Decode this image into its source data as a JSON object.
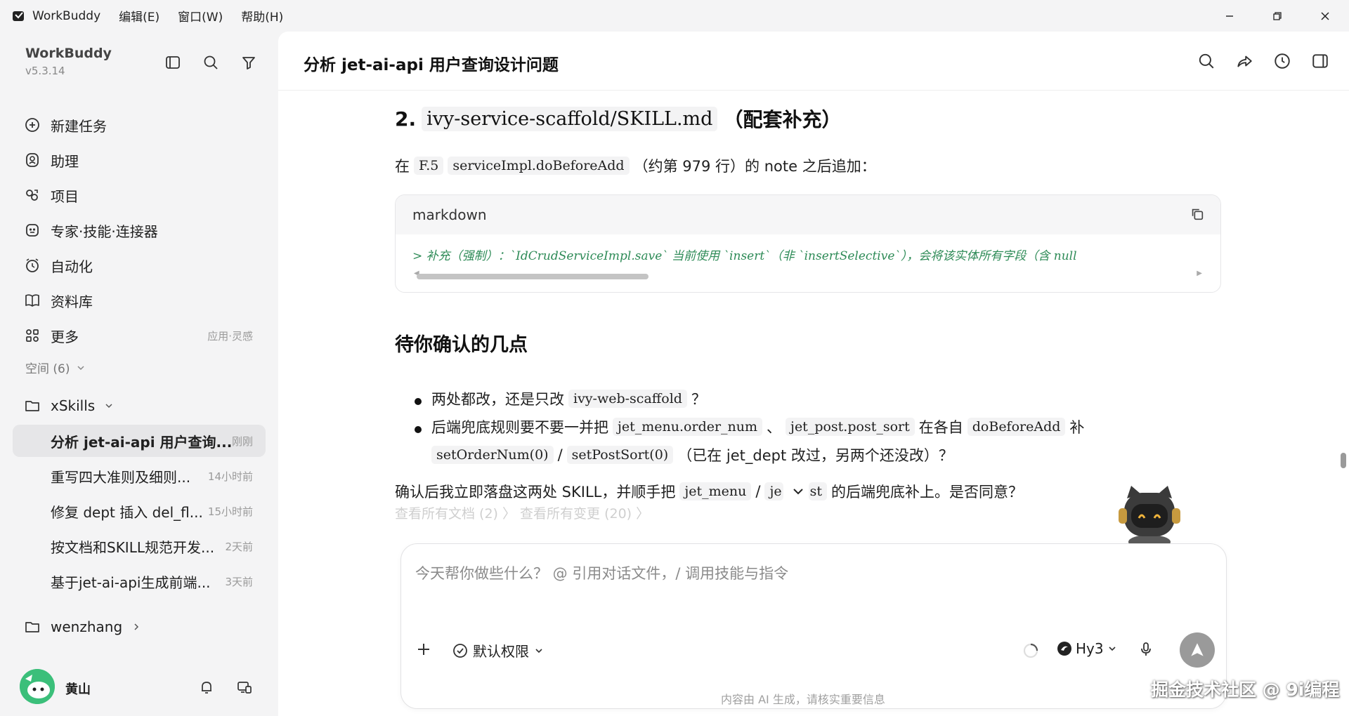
{
  "titlebar": {
    "app_name": "WorkBuddy",
    "menus": [
      "编辑(E)",
      "窗口(W)",
      "帮助(H)"
    ]
  },
  "sidebar": {
    "brand": "WorkBuddy",
    "version": "v5.3.14",
    "nav": [
      {
        "label": "新建任务",
        "icon": "plus-circle-icon"
      },
      {
        "label": "助理",
        "icon": "assistant-icon"
      },
      {
        "label": "项目",
        "icon": "project-icon"
      },
      {
        "label": "专家·技能·连接器",
        "icon": "expert-icon"
      },
      {
        "label": "自动化",
        "icon": "alarm-clock-icon"
      },
      {
        "label": "资料库",
        "icon": "book-icon"
      },
      {
        "label": "更多",
        "icon": "grid-icon",
        "hint": "应用·灵感"
      }
    ],
    "space_header": "空间 (6)",
    "folders": {
      "xskills": "xSkills",
      "wenzhang": "wenzhang"
    },
    "tasks": [
      {
        "title": "分析 jet-ai-api 用户查询...",
        "time": "刚刚"
      },
      {
        "title": "重写四大准则及细则...",
        "time": "14小时前"
      },
      {
        "title": "修复 dept 插入 del_fl...",
        "time": "15小时前"
      },
      {
        "title": "按文档和SKILL规范开发...",
        "time": "2天前"
      },
      {
        "title": "基于jet-ai-api生成前端...",
        "time": "3天前"
      }
    ],
    "user": {
      "name": "黄山"
    }
  },
  "main": {
    "title": "分析 jet-ai-api 用户查询设计问题",
    "section2": {
      "prefix": "2.",
      "code": "ivy-service-scaffold/SKILL.md",
      "suffix": "（配套补充）"
    },
    "para1": {
      "a": "在",
      "code1": "F.5",
      "code2": "serviceImpl.doBeforeAdd",
      "b": "（约第 979 行）的 note 之后追加："
    },
    "codeblock": {
      "lang": "markdown",
      "line": "> 补充（强制）：`IdCrudServiceImpl.save` 当前使用 `insert`（非 `insertSelective`），会将该实体所有字段（含 null"
    },
    "confirm_heading": "待你确认的几点",
    "bullet1": {
      "a": "两处都改，还是只改",
      "code": "ivy-web-scaffold",
      "b": "？"
    },
    "bullet2": {
      "a": "后端兜底规则要不要一并把",
      "code1": "jet_menu.order_num",
      "sep": "、",
      "code2": "jet_post.post_sort",
      "b": "在各自",
      "code3": "doBeforeAdd",
      "c": "补",
      "code4": "setOrderNum(0)",
      "slash": "/",
      "code5": "setPostSort(0)",
      "d": "（已在 jet_dept 改过，另两个还没改）？"
    },
    "para_final": {
      "a": "确认后我立即落盘这两处 SKILL，并顺手把",
      "code1": "jet_menu",
      "slash": "/",
      "code2a": "je",
      "code2b": "st",
      "b": "的后端兜底补上。是否同意？"
    },
    "faded_line": "查看所有文档 (2) 〉   查看所有变更 (20) 〉"
  },
  "composer": {
    "placeholder": "今天帮你做些什么？ @ 引用对话文件，/ 调用技能与指令",
    "permission": "默认权限",
    "model": "Hy3"
  },
  "footer": {
    "disclaimer": "内容由 AI 生成，请核实重要信息",
    "watermark": "掘金技术社区 @ 9i编程"
  },
  "colors": {
    "accent_green": "#2e8b57",
    "avatar_green": "#3bbf7a"
  }
}
